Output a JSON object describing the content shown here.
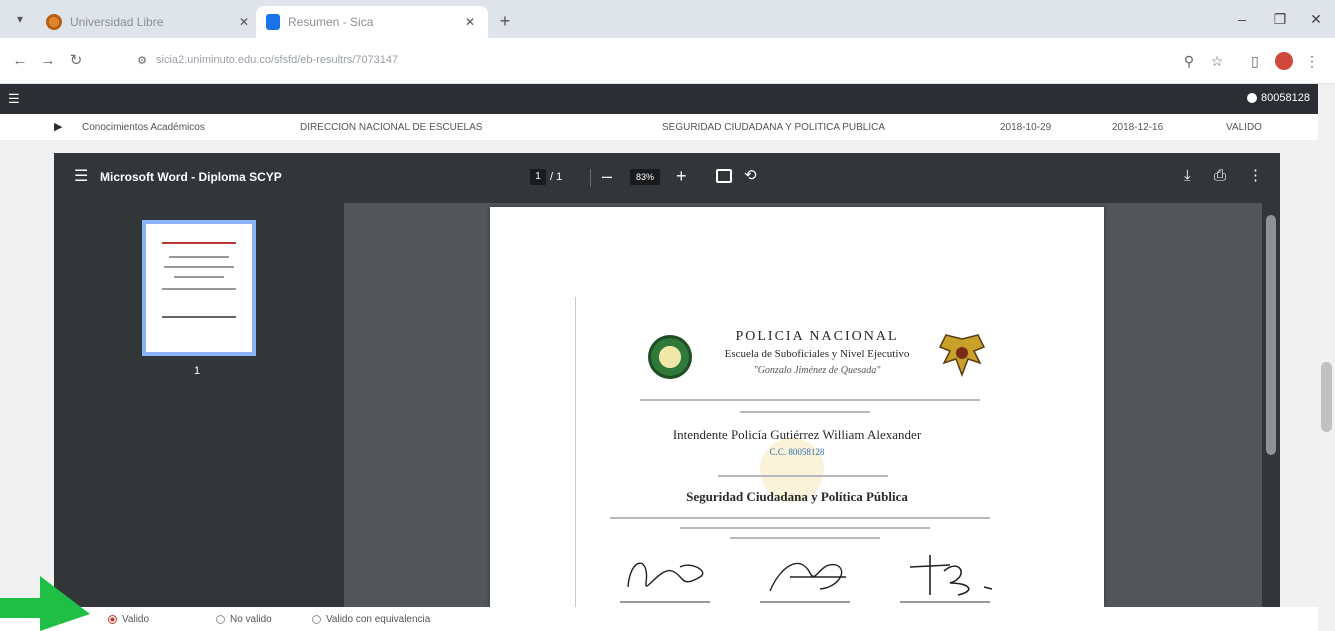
{
  "browser": {
    "tabs": [
      {
        "title": "Universidad Libre",
        "active": false
      },
      {
        "title": "Resumen - Sica",
        "active": true
      }
    ],
    "url": "sicia2.uniminuto.edu.co/sfsfd/eb-resultrs/7073147",
    "icons": {
      "menu": "tab-search-icon",
      "back": "back-arrow-icon",
      "forward": "forward-arrow-icon",
      "reload": "reload-icon",
      "site": "site-info-icon",
      "zoom": "zoom-icon",
      "star": "bookmark-star-icon",
      "sidepanel": "side-panel-icon",
      "profile": "profile-icon",
      "kebab": "more-vert-icon"
    }
  },
  "app": {
    "user_label": "80058128"
  },
  "record": {
    "type": "Conocimientos Académicos",
    "institution": "DIRECCION NACIONAL DE ESCUELAS",
    "program": "SEGURIDAD CIUDADANA Y POLITICA PUBLICA",
    "start_date": "2018-10-29",
    "end_date": "2018-12-16",
    "status": "VALIDO"
  },
  "pdf_viewer": {
    "title": "Microsoft Word - Diploma SCYP",
    "page_current": "1",
    "page_total": "/ 1",
    "zoom": "83%",
    "thumbnail_page": "1",
    "progress": 0.0
  },
  "diploma": {
    "header": "POLICIA NACIONAL",
    "school": "Escuela de Suboficiales y Nivel Ejecutivo",
    "motto": "\"Gonzalo Jiménez de Quesada\"",
    "recipient": "Intendente Policía Gutiérrez William Alexander",
    "id_line": "C.C. 80058128",
    "course": "Seguridad Ciudadana y Política Pública"
  },
  "options": {
    "valid_label": "Valido",
    "not_valid_label": "No valido",
    "equiv_label": "Valido con equivalencia",
    "selected": "valid"
  },
  "colors": {
    "accent_green": "#1fbf45",
    "pdf_dark": "#323639",
    "app_header": "#2b2e33"
  }
}
